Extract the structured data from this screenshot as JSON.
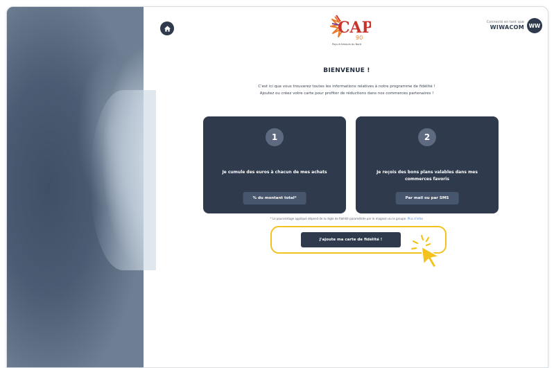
{
  "header": {
    "home_icon": "home-icon",
    "logo_text": "CAP",
    "logo_subtext": "90",
    "logo_caption": "Pays d'Arlequin du Nord",
    "brand_small": "Connecté en tant que",
    "brand_name": "WIWACOM",
    "avatar_initials": "WW"
  },
  "main": {
    "title": "BIENVENUE !",
    "intro_line1": "C'est ici que vous trouverez toutes les informations relatives à notre programme de fidélité !",
    "intro_line2": "Ajoutez ou créez votre carte pour profiter de réductions dans nos commerces partenaires !",
    "cards": [
      {
        "number": "1",
        "text": "Je cumule des euros à chacun de mes achats",
        "button": "% du montant total*"
      },
      {
        "number": "2",
        "text": "Je reçois des bons plans valables dans mes commerces favoris",
        "button": "Par mail ou par SMS"
      }
    ],
    "footnote": "* Le pourcentage appliqué dépend de la règle de fidélité paramétrée par le magasin ou le groupe.",
    "footnote_link": "Plus d'infos",
    "cta_label": "J'ajoute ma carte de fidélité !"
  },
  "colors": {
    "navy": "#2f3b4d",
    "highlight": "#f4c21c",
    "cursor": "#f4c21c"
  }
}
